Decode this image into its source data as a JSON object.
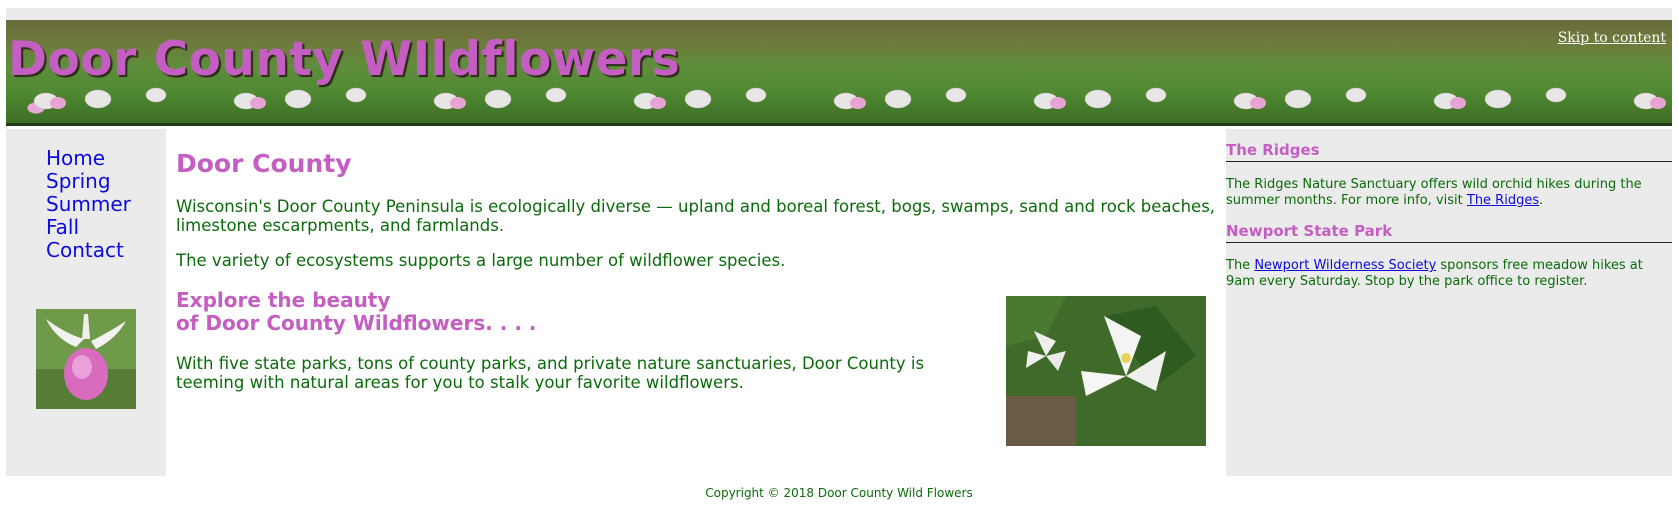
{
  "header": {
    "title": "Door County WIldflowers",
    "skip_link": "Skip to content"
  },
  "nav": {
    "items": [
      {
        "label": "Home"
      },
      {
        "label": "Spring"
      },
      {
        "label": "Summer"
      },
      {
        "label": "Fall"
      },
      {
        "label": "Contact"
      }
    ]
  },
  "main": {
    "heading": "Door County",
    "paragraph1": "Wisconsin's Door County Peninsula is ecologically diverse — upland and boreal forest, bogs, swamps, sand and rock beaches, limestone escarpments, and farmlands.",
    "paragraph2": "The variety of ecosystems supports a large number of wildflower species.",
    "subheading_line1": "Explore the beauty",
    "subheading_line2": "of Door County Wildflowers. . . .",
    "paragraph3": "With five state parks, tons of county parks, and private nature sanctuaries, Door County is teeming with natural areas for you to stalk your favorite wildflowers."
  },
  "sidebar": {
    "ridges": {
      "heading": "The Ridges",
      "text_before": "The Ridges Nature Sanctuary offers wild orchid hikes during the summer months. For more info, visit ",
      "link": "The Ridges",
      "text_after": "."
    },
    "newport": {
      "heading": "Newport State Park",
      "text_before": "The ",
      "link": "Newport Wilderness Society",
      "text_after": " sponsors free meadow hikes at 9am every Saturday. Stop by the park office to register."
    }
  },
  "footer": {
    "copyright": "Copyright © 2018 Door County Wild Flowers"
  },
  "colors": {
    "accent": "#c55ec2",
    "text": "#0b6b0b",
    "link": "#0b0bdc",
    "panel": "#ebebeb"
  }
}
